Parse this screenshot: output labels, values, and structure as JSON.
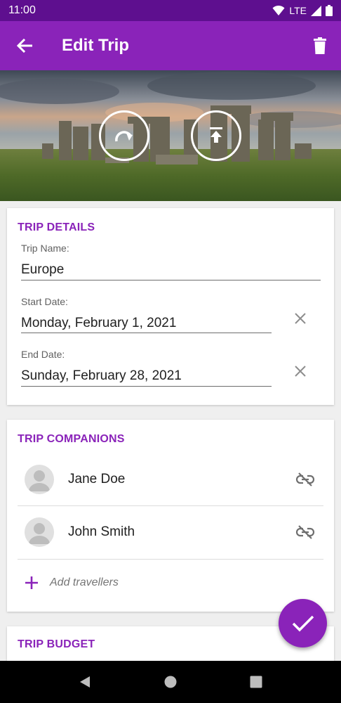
{
  "status_bar": {
    "time": "11:00",
    "network": "LTE"
  },
  "app_bar": {
    "title": "Edit Trip"
  },
  "hero": {
    "image_desc_icon": "stonehenge-photo"
  },
  "trip_details": {
    "title": "TRIP DETAILS",
    "name_label": "Trip Name:",
    "name_value": "Europe",
    "start_label": "Start Date:",
    "start_value": "Monday, February 1, 2021",
    "end_label": "End Date:",
    "end_value": "Sunday, February 28, 2021"
  },
  "companions": {
    "title": "TRIP COMPANIONS",
    "people": [
      {
        "name": "Jane Doe"
      },
      {
        "name": "John Smith"
      }
    ],
    "add_label": "Add travellers"
  },
  "budget": {
    "title": "TRIP BUDGET"
  },
  "colors": {
    "primary": "#8a23b9",
    "status_bar": "#5e0f8f",
    "accent_text": "#8a23b9"
  }
}
